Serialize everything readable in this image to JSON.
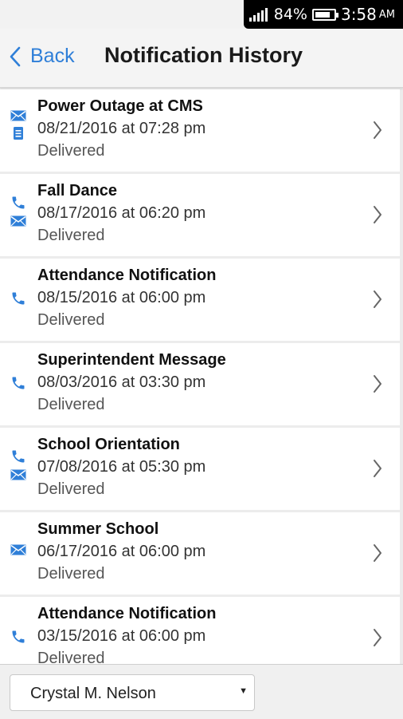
{
  "status_bar": {
    "battery_percent": "84%",
    "battery_level": 0.84,
    "time": "3:58",
    "ampm": "AM"
  },
  "header": {
    "back_label": "Back",
    "title": "Notification History"
  },
  "accent_color": "#2f7fd8",
  "notifications": [
    {
      "title": "Power Outage at CMS",
      "date": "08/21/2016 at 07:28 pm",
      "status": "Delivered",
      "icons": [
        "email-icon",
        "text-message-icon"
      ]
    },
    {
      "title": "Fall Dance",
      "date": "08/17/2016 at 06:20 pm",
      "status": "Delivered",
      "icons": [
        "phone-icon",
        "email-icon"
      ]
    },
    {
      "title": "Attendance Notification",
      "date": "08/15/2016 at 06:00 pm",
      "status": "Delivered",
      "icons": [
        "phone-icon"
      ]
    },
    {
      "title": "Superintendent Message",
      "date": "08/03/2016 at 03:30 pm",
      "status": "Delivered",
      "icons": [
        "phone-icon"
      ]
    },
    {
      "title": "School Orientation",
      "date": "07/08/2016 at 05:30 pm",
      "status": "Delivered",
      "icons": [
        "phone-icon",
        "email-icon"
      ]
    },
    {
      "title": "Summer School",
      "date": "06/17/2016 at 06:00 pm",
      "status": "Delivered",
      "icons": [
        "email-icon"
      ]
    },
    {
      "title": "Attendance Notification",
      "date": "03/15/2016 at 06:00 pm",
      "status": "Delivered",
      "icons": [
        "phone-icon"
      ]
    }
  ],
  "footer": {
    "selected_recipient": "Crystal M. Nelson"
  }
}
